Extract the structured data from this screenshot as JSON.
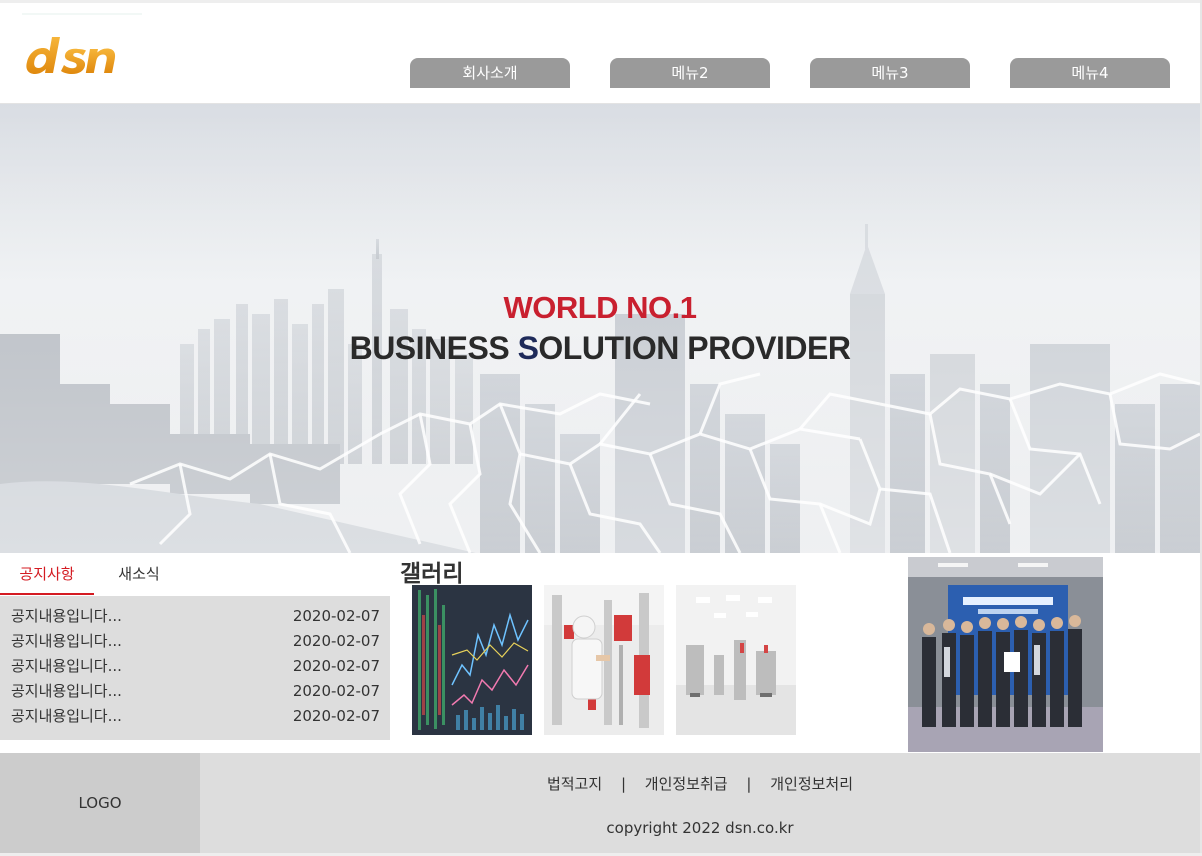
{
  "header": {
    "logo_text": "dsn",
    "nav": [
      "회사소개",
      "메뉴2",
      "메뉴3",
      "메뉴4"
    ]
  },
  "hero": {
    "line1": "WORLD NO.1",
    "line2_prefix": "BUSINESS ",
    "line2_highlight": "S",
    "line2_suffix": "OLUTION PROVIDER"
  },
  "notice": {
    "tabs": [
      "공지사항",
      "새소식"
    ],
    "items": [
      {
        "title": "공지내용입니다...",
        "date": "2020-02-07"
      },
      {
        "title": "공지내용입니다...",
        "date": "2020-02-07"
      },
      {
        "title": "공지내용입니다...",
        "date": "2020-02-07"
      },
      {
        "title": "공지내용입니다...",
        "date": "2020-02-07"
      },
      {
        "title": "공지내용입니다...",
        "date": "2020-02-07"
      }
    ]
  },
  "gallery": {
    "title": "갤러리"
  },
  "footer": {
    "logo": "LOGO",
    "links": [
      "법적고지",
      "개인정보취급",
      "개인정보처리"
    ],
    "separator": "|",
    "copyright": "copyright 2022 dsn.co.kr"
  },
  "colors": {
    "accent_red": "#d41b22",
    "nav_gray": "#9a9a9a",
    "hero_red": "#c9202f",
    "hero_navy": "#1e2a5a"
  }
}
